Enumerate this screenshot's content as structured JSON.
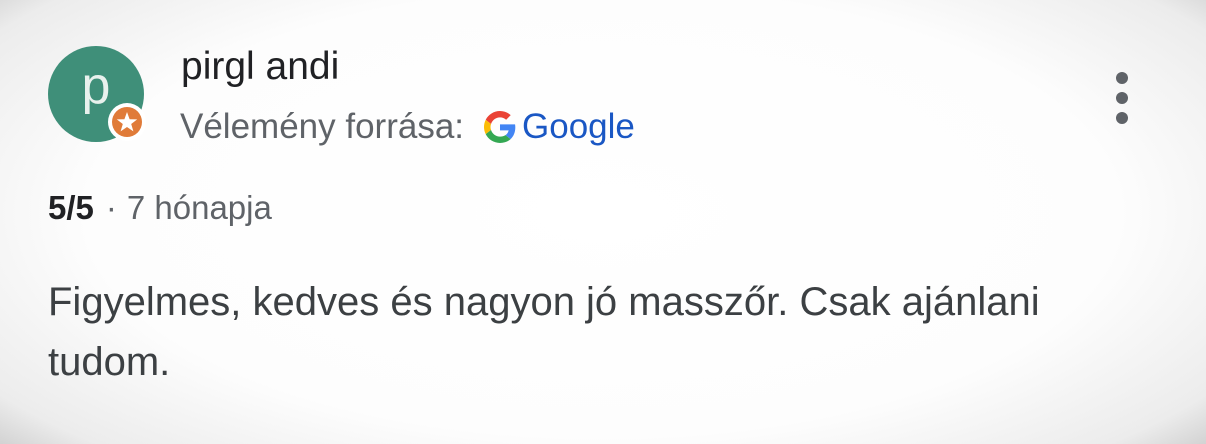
{
  "review": {
    "author": {
      "avatar_letter": "p",
      "avatar_color": "#3f8f79",
      "name": "pirgl andi",
      "badge_icon": "local-guide-star-icon",
      "badge_color": "#e07b39"
    },
    "source": {
      "label": "Vélemény forrása:",
      "provider_icon": "google-g-icon",
      "provider_name": "Google",
      "provider_color": "#1a57c4"
    },
    "more_icon": "more-vertical-icon",
    "rating": "5/5",
    "separator": "·",
    "age": "7 hónapja",
    "text": "Figyelmes, kedves és nagyon jó masszőr. Csak ajánlani tudom."
  }
}
